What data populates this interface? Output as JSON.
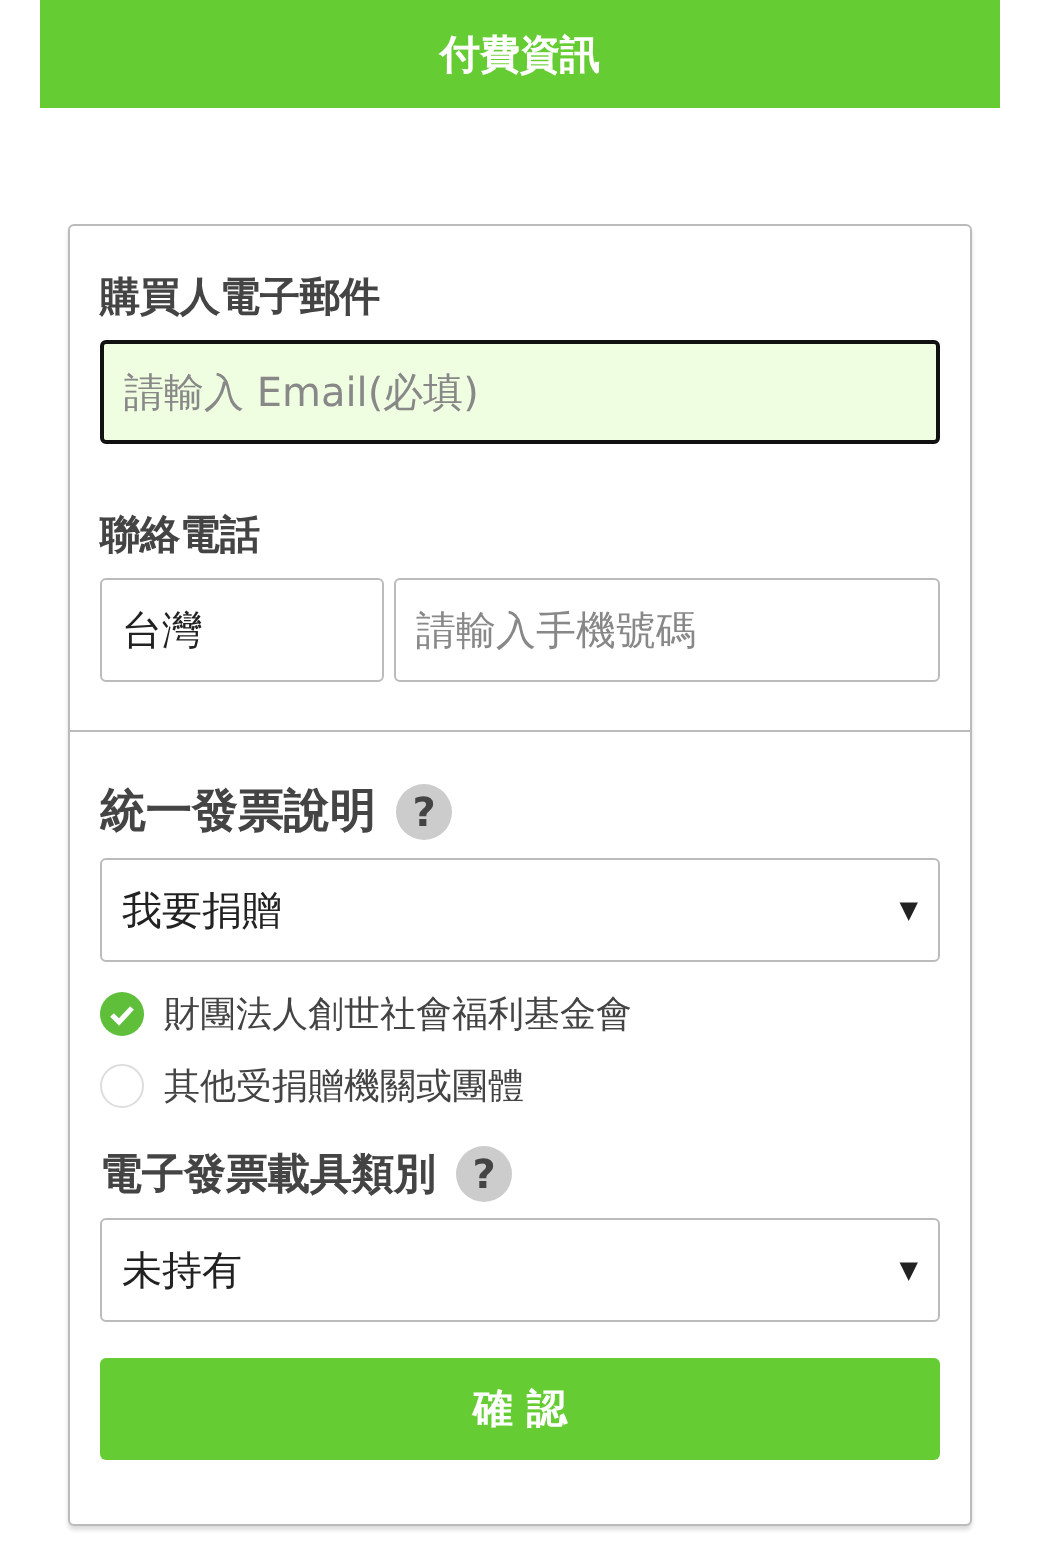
{
  "header": {
    "title": "付費資訊"
  },
  "email": {
    "label": "購買人電子郵件",
    "placeholder": "請輸入 Email(必填)",
    "focused": true
  },
  "phone": {
    "label": "聯絡電話",
    "country": "台灣",
    "placeholder": "請輸入手機號碼"
  },
  "invoice": {
    "label": "統一發票說明",
    "help": "?",
    "value": "我要捐贈",
    "caret": "▼",
    "options": [
      {
        "label": "財團法人創世社會福利基金會",
        "selected": true
      },
      {
        "label": "其他受捐贈機關或團體",
        "selected": false
      }
    ]
  },
  "carrier": {
    "label": "電子發票載具類別",
    "help": "?",
    "value": "未持有",
    "caret": "▼"
  },
  "confirm_button": "確 認"
}
